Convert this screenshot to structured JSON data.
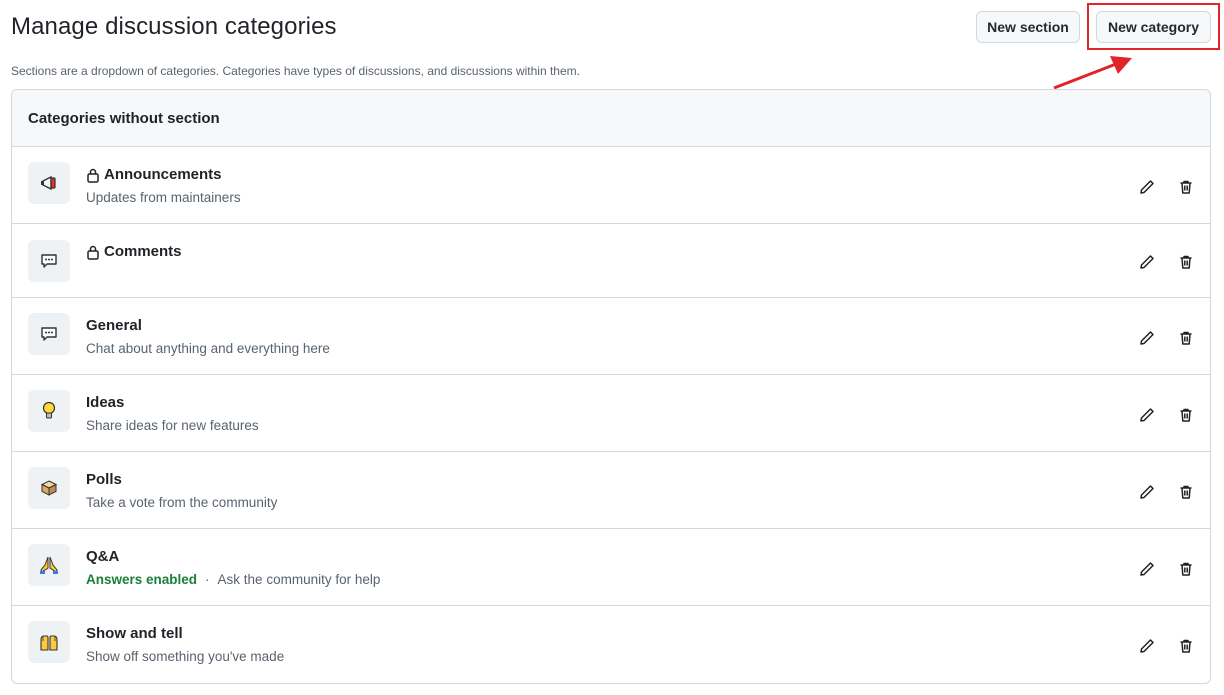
{
  "header": {
    "title": "Manage discussion categories",
    "subtitle": "Sections are a dropdown of categories. Categories have types of discussions, and discussions within them.",
    "new_section_label": "New section",
    "new_category_label": "New category"
  },
  "panel": {
    "title": "Categories without section"
  },
  "categories": [
    {
      "name": "Announcements",
      "description": "Updates from maintainers",
      "locked": true,
      "emoji": "mega"
    },
    {
      "name": "Comments",
      "description": "",
      "locked": true,
      "emoji": "speech-balloon"
    },
    {
      "name": "General",
      "description": "Chat about anything and everything here",
      "locked": false,
      "emoji": "speech-balloon"
    },
    {
      "name": "Ideas",
      "description": "Share ideas for new features",
      "locked": false,
      "emoji": "bulb"
    },
    {
      "name": "Polls",
      "description": "Take a vote from the community",
      "locked": false,
      "emoji": "ballot-box"
    },
    {
      "name": "Q&A",
      "answers_label": "Answers enabled",
      "description": "Ask the community for help",
      "locked": false,
      "emoji": "pray"
    },
    {
      "name": "Show and tell",
      "description": "Show off something you've made",
      "locked": false,
      "emoji": "raised-hands"
    }
  ],
  "colors": {
    "accent_green": "#1a7f37",
    "annotation_red": "#e0242a",
    "border": "#d1d9e0"
  }
}
